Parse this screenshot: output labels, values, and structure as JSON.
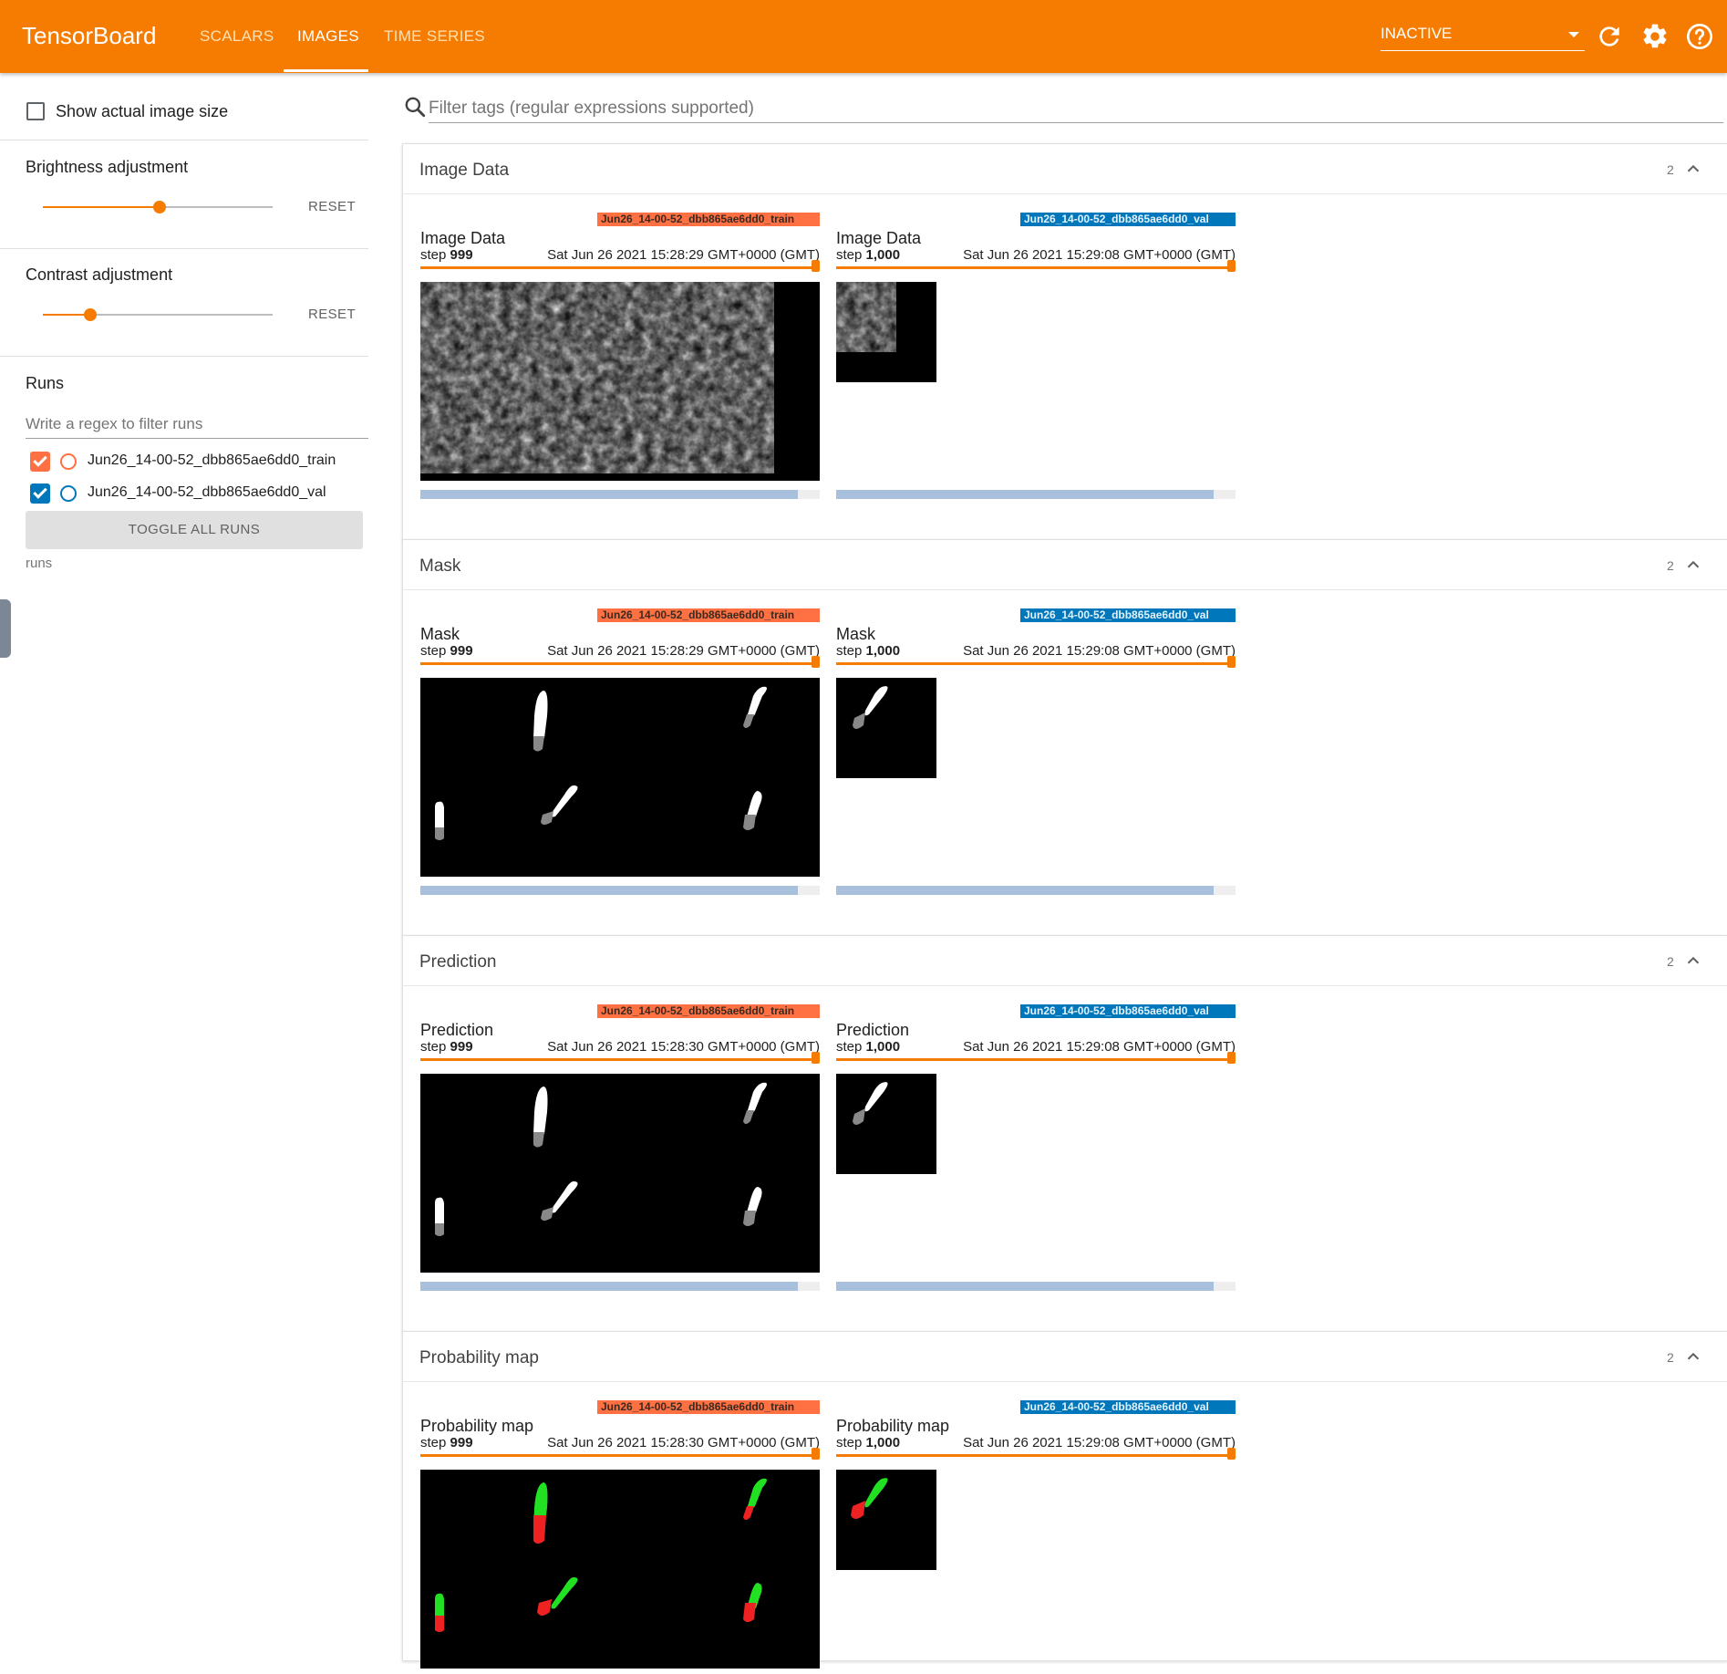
{
  "header": {
    "brand": "TensorBoard",
    "tabs": [
      {
        "label": "SCALARS",
        "active": false
      },
      {
        "label": "IMAGES",
        "active": true
      },
      {
        "label": "TIME SERIES",
        "active": false
      }
    ],
    "run_state": "INACTIVE",
    "icons": [
      "reload-icon",
      "settings-icon",
      "help-icon"
    ]
  },
  "sidebar": {
    "actual_size_label": "Show actual image size",
    "actual_size_checked": false,
    "brightness_label": "Brightness adjustment",
    "brightness_value": 0.5,
    "contrast_label": "Contrast adjustment",
    "contrast_value": 0.2,
    "reset_label": "RESET",
    "runs_title": "Runs",
    "runs_filter_placeholder": "Write a regex to filter runs",
    "runs": [
      {
        "name": "Jun26_14-00-52_dbb865ae6dd0_train",
        "color": "#ff7043",
        "checked": true
      },
      {
        "name": "Jun26_14-00-52_dbb865ae6dd0_val",
        "color": "#0077bb",
        "checked": true
      }
    ],
    "toggle_all_label": "TOGGLE ALL RUNS",
    "footer_label": "runs"
  },
  "main": {
    "filter_placeholder": "Filter tags (regular expressions supported)",
    "step_label": "step",
    "cards": [
      {
        "title": "Image Data",
        "count": "2",
        "panes": [
          {
            "tag": "Image Data",
            "run": "Jun26_14-00-52_dbb865ae6dd0_train",
            "step": "999",
            "time": "Sat Jun 26 2021 15:28:29 GMT+0000 (GMT)"
          },
          {
            "tag": "Image Data",
            "run": "Jun26_14-00-52_dbb865ae6dd0_val",
            "step": "1,000",
            "time": "Sat Jun 26 2021 15:29:08 GMT+0000 (GMT)"
          }
        ]
      },
      {
        "title": "Mask",
        "count": "2",
        "panes": [
          {
            "tag": "Mask",
            "run": "Jun26_14-00-52_dbb865ae6dd0_train",
            "step": "999",
            "time": "Sat Jun 26 2021 15:28:29 GMT+0000 (GMT)"
          },
          {
            "tag": "Mask",
            "run": "Jun26_14-00-52_dbb865ae6dd0_val",
            "step": "1,000",
            "time": "Sat Jun 26 2021 15:29:08 GMT+0000 (GMT)"
          }
        ]
      },
      {
        "title": "Prediction",
        "count": "2",
        "panes": [
          {
            "tag": "Prediction",
            "run": "Jun26_14-00-52_dbb865ae6dd0_train",
            "step": "999",
            "time": "Sat Jun 26 2021 15:28:30 GMT+0000 (GMT)"
          },
          {
            "tag": "Prediction",
            "run": "Jun26_14-00-52_dbb865ae6dd0_val",
            "step": "1,000",
            "time": "Sat Jun 26 2021 15:29:08 GMT+0000 (GMT)"
          }
        ]
      },
      {
        "title": "Probability map",
        "count": "2",
        "panes": [
          {
            "tag": "Probability map",
            "run": "Jun26_14-00-52_dbb865ae6dd0_train",
            "step": "999",
            "time": "Sat Jun 26 2021 15:28:30 GMT+0000 (GMT)"
          },
          {
            "tag": "Probability map",
            "run": "Jun26_14-00-52_dbb865ae6dd0_val",
            "step": "1,000",
            "time": "Sat Jun 26 2021 15:29:08 GMT+0000 (GMT)"
          }
        ]
      }
    ]
  }
}
